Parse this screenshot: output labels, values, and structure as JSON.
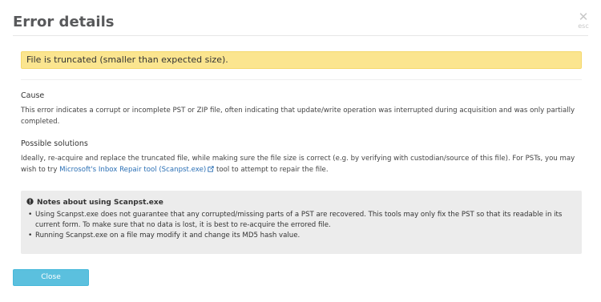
{
  "dialog": {
    "title": "Error details",
    "close_x_glyph": "✕",
    "close_x_hint": "esc"
  },
  "error_message": "File is truncated (smaller than expected size).",
  "cause": {
    "heading": "Cause",
    "text": "This error indicates a corrupt or incomplete PST or ZIP file, often indicating that update/write operation was interrupted during acquisition and was only partially completed."
  },
  "solutions": {
    "heading": "Possible solutions",
    "text_before_link": "Ideally, re-acquire and replace the truncated file, while making sure the file size is correct (e.g. by verifying with custodian/source of this file). For PSTs, you may wish to try ",
    "link_text": "Microsoft's Inbox Repair tool (Scanpst.exe)",
    "text_after_link": " tool to attempt to repair the file."
  },
  "notes": {
    "title": "Notes about using Scanpst.exe",
    "items": [
      "Using Scanpst.exe does not guarantee that any corrupted/missing parts of a PST are recovered. This tools may only fix the PST so that its readable in its current form. To make sure that no data is lost, it is best to re-acquire the errored file.",
      "Running Scanpst.exe on a file may modify it and change its MD5 hash value."
    ]
  },
  "footer": {
    "close_label": "Close"
  },
  "icons": {
    "close": "close-icon",
    "external_link": "external-link-icon",
    "info": "exclamation-circle-icon"
  },
  "colors": {
    "warning_bg": "#fbe58f",
    "notes_bg": "#ececec",
    "button_bg": "#5bc0de",
    "link": "#2a6fb5"
  }
}
